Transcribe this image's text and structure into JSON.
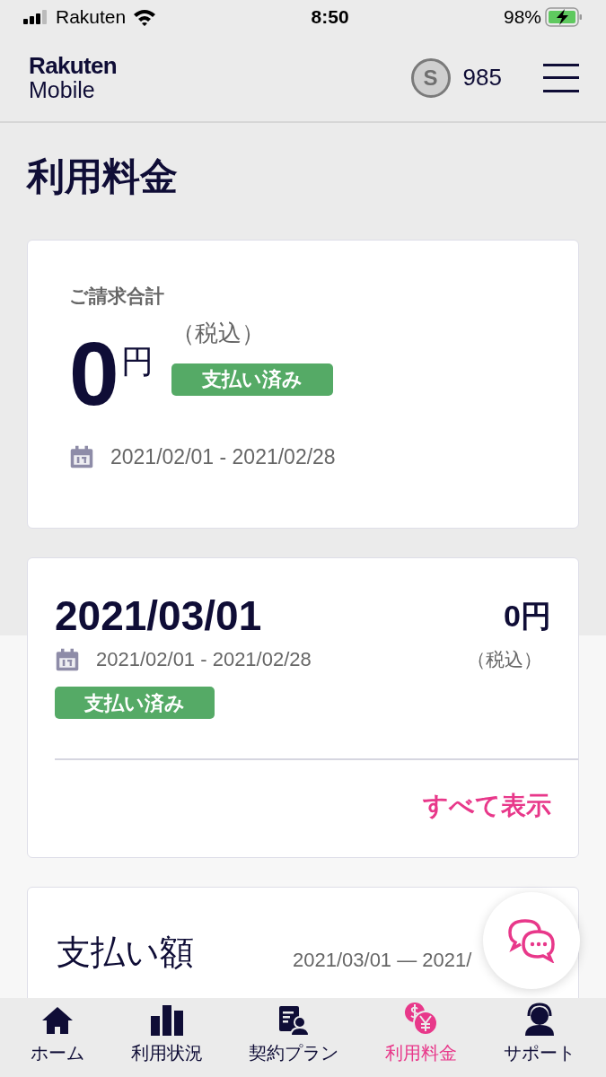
{
  "status_bar": {
    "carrier": "Rakuten",
    "time": "8:50",
    "battery": "98%"
  },
  "header": {
    "logo_top": "Rakuten",
    "logo_bottom": "Mobile",
    "points_symbol": "S",
    "points": "985"
  },
  "page_title": "利用料金",
  "summary_card": {
    "label": "ご請求合計",
    "amount": "0",
    "unit": "円",
    "tax": "（税込）",
    "status": "支払い済み",
    "period": "2021/02/01 - 2021/02/28"
  },
  "bill_card": {
    "date": "2021/03/01",
    "amount": "0円",
    "tax": "（税込）",
    "period": "2021/02/01 - 2021/02/28",
    "status": "支払い済み",
    "link": "すべて表示"
  },
  "payment_card": {
    "title": "支払い額",
    "period": "2021/03/01 — 2021/"
  },
  "bottom_nav": [
    {
      "label": "ホーム",
      "kind": "home",
      "selected": false
    },
    {
      "label": "利用状況",
      "kind": "usage",
      "selected": false
    },
    {
      "label": "契約プラン",
      "kind": "plan",
      "selected": false
    },
    {
      "label": "利用料金",
      "kind": "billing",
      "selected": true
    },
    {
      "label": "サポート",
      "kind": "support",
      "selected": false
    }
  ]
}
